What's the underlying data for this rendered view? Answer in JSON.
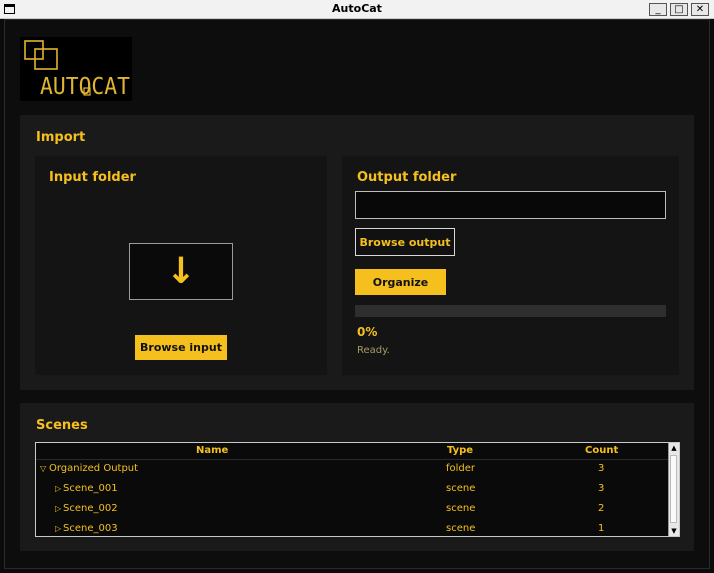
{
  "window": {
    "title": "AutoCat",
    "minimize": "_",
    "maximize": "□",
    "close": "✕"
  },
  "logo": {
    "text": "AUTOCAT"
  },
  "import": {
    "heading": "Import",
    "input_heading": "Input folder",
    "drop_arrow": "↓",
    "browse_input": "Browse input",
    "output_heading": "Output folder",
    "output_value": "",
    "browse_output": "Browse output",
    "organize": "Organize",
    "progress": 0,
    "percent": "0%",
    "status": "Ready."
  },
  "scenes": {
    "heading": "Scenes",
    "columns": {
      "name": "Name",
      "type": "Type",
      "count": "Count"
    },
    "rows": [
      {
        "expander": "▽",
        "name": "Organized Output",
        "type": "folder",
        "count": "3"
      },
      {
        "expander": "▷",
        "name": "Scene_001",
        "type": "scene",
        "count": "3"
      },
      {
        "expander": "▷",
        "name": "Scene_002",
        "type": "scene",
        "count": "2"
      },
      {
        "expander": "▷",
        "name": "Scene_003",
        "type": "scene",
        "count": "1"
      }
    ]
  },
  "colors": {
    "accent": "#f5c01e",
    "background": "#0b0b0b",
    "panel": "#1a1a1a"
  }
}
